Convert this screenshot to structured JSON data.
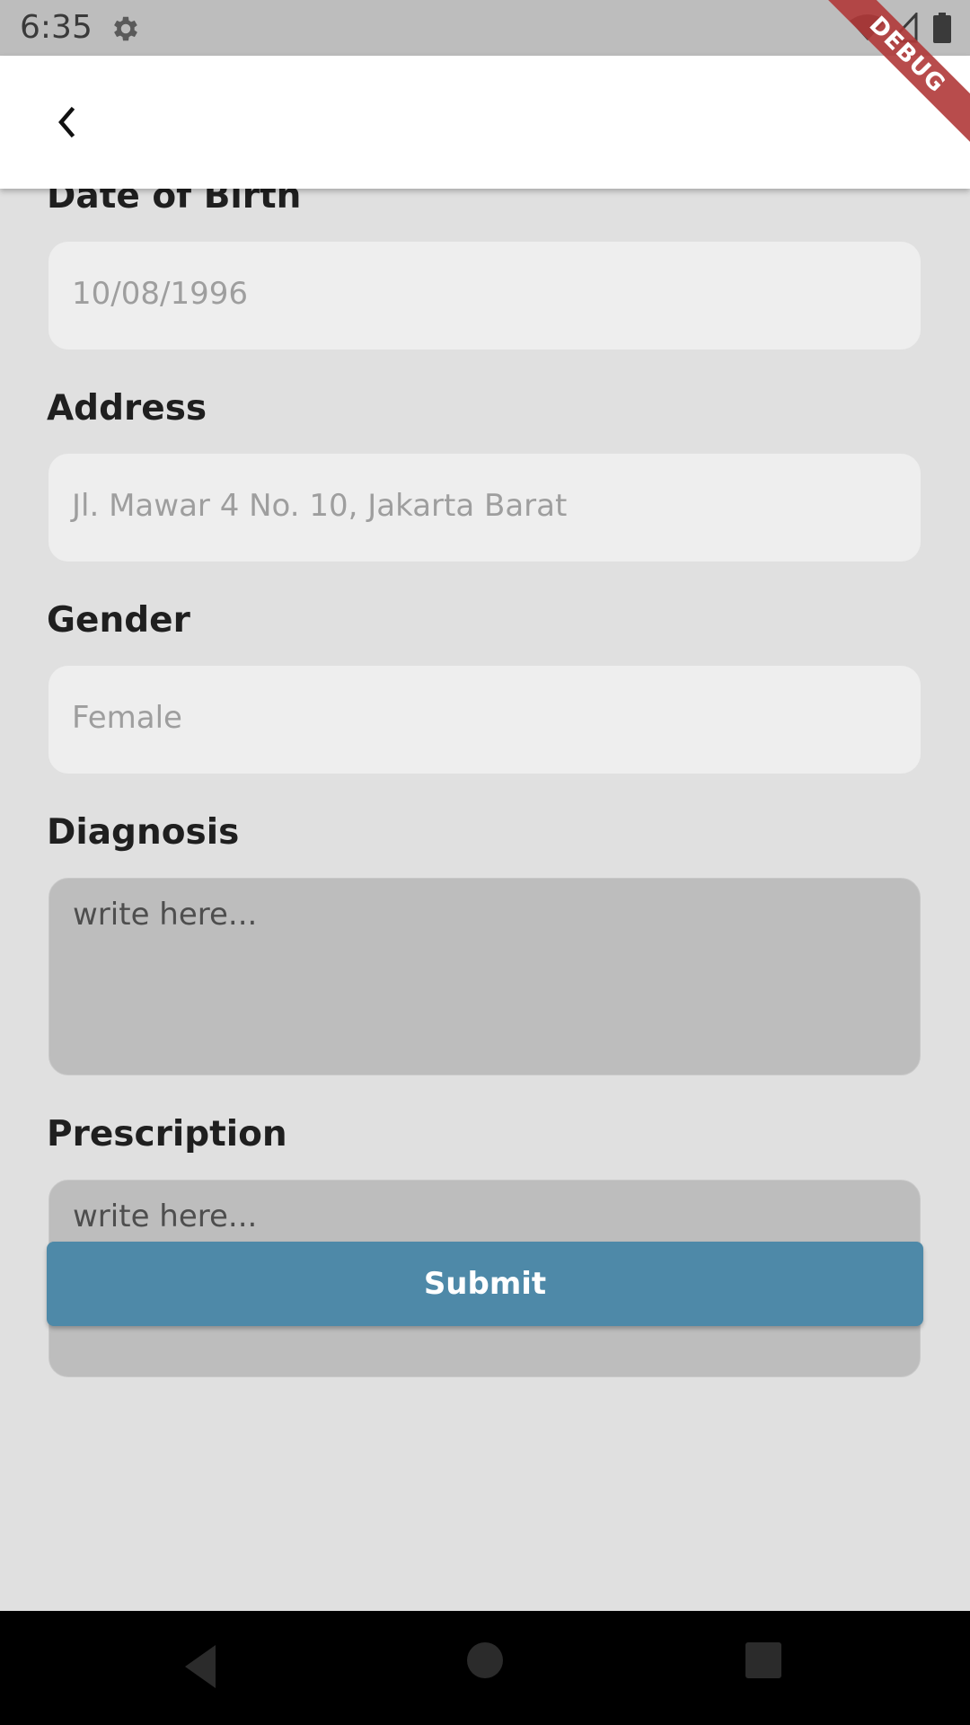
{
  "status_bar": {
    "time": "6:35"
  },
  "debug_banner": {
    "label": "DEBUG"
  },
  "form": {
    "fields": [
      {
        "label": "Date of Birth",
        "value": "10/08/1996"
      },
      {
        "label": "Address",
        "value": "Jl. Mawar 4 No. 10, Jakarta Barat"
      },
      {
        "label": "Gender",
        "value": "Female"
      }
    ],
    "diagnosis": {
      "label": "Diagnosis",
      "placeholder": "write here..."
    },
    "prescription": {
      "label": "Prescription",
      "placeholder": "write here..."
    },
    "submit_label": "Submit"
  },
  "colors": {
    "accent": "#4e89a8",
    "background": "#e0e0e0",
    "debug_ribbon": "#b03838"
  },
  "icons": {
    "status": [
      "settings-icon",
      "wifi-icon",
      "signal-icon",
      "battery-icon"
    ],
    "app_bar": "chevron-left-icon",
    "navigation": [
      "nav-back-icon",
      "nav-home-icon",
      "nav-recents-icon"
    ]
  }
}
